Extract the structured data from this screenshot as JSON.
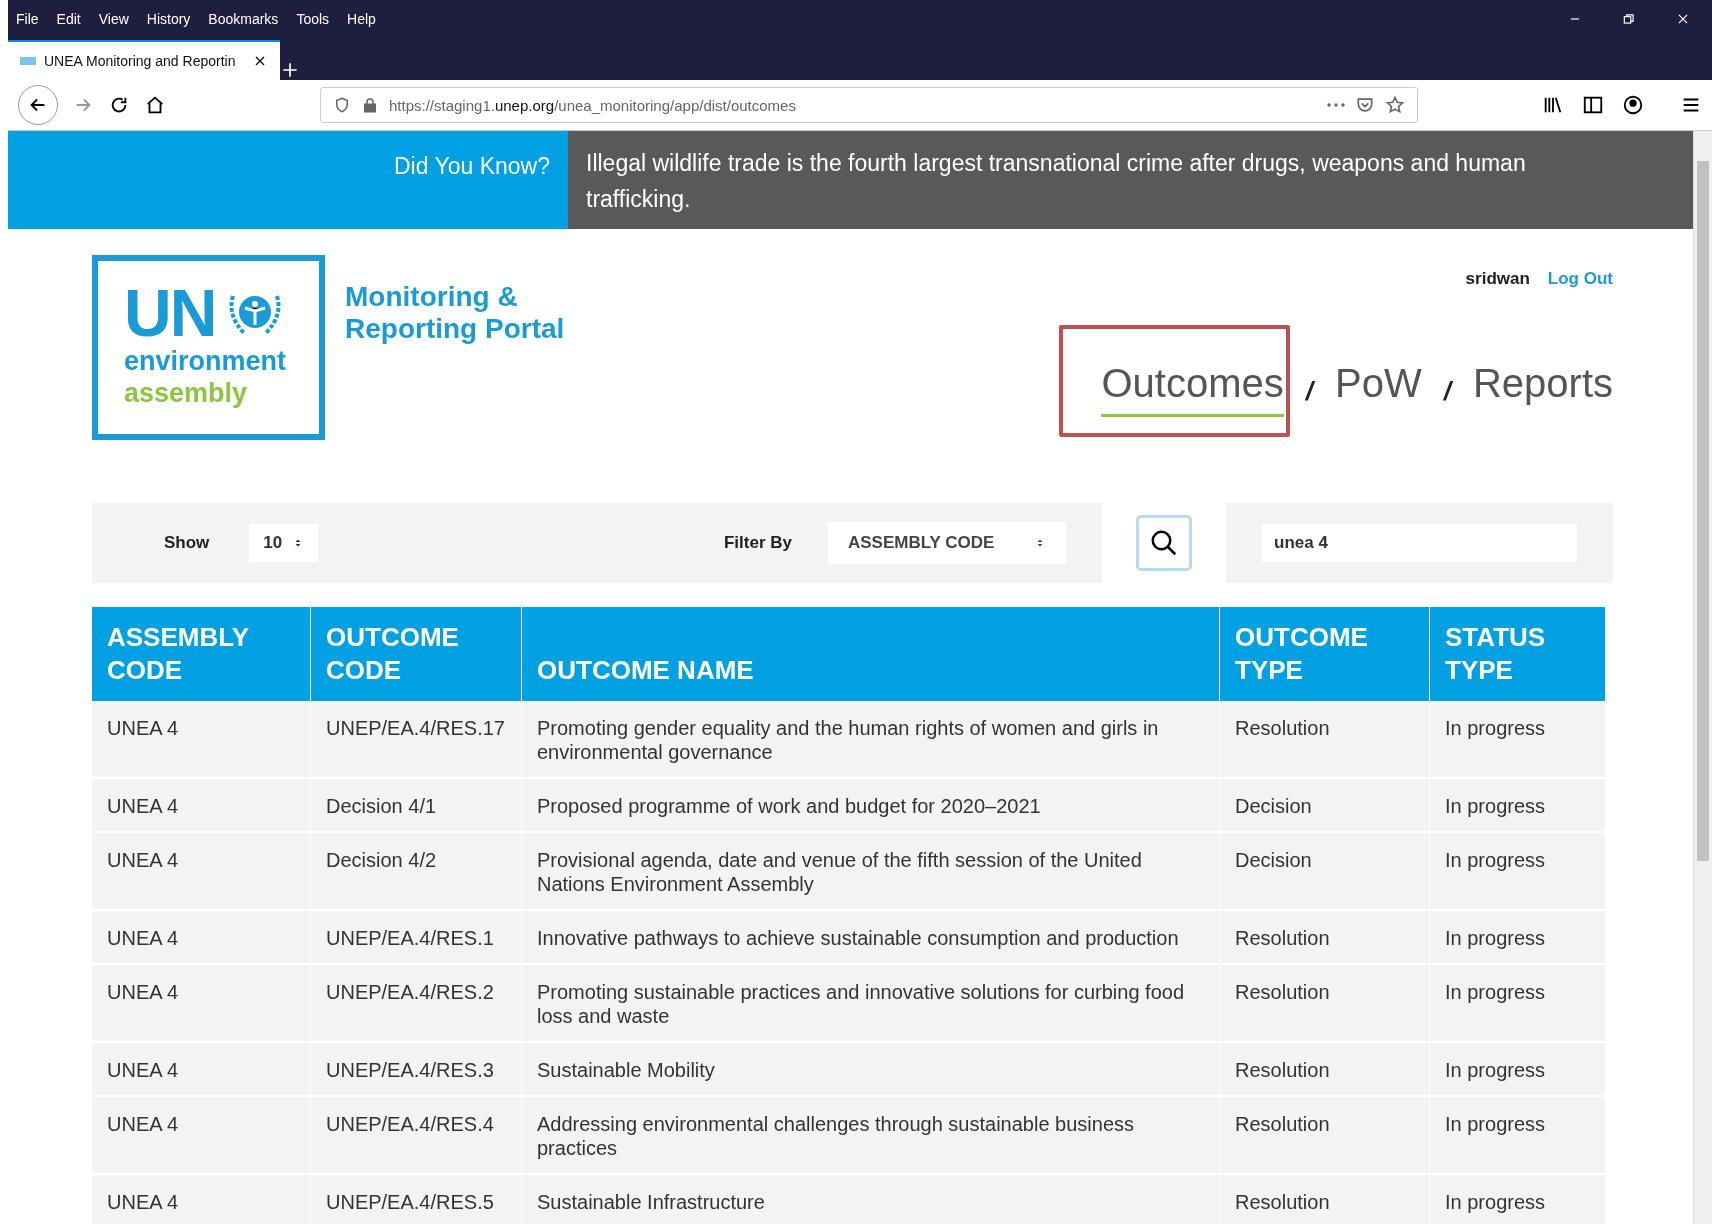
{
  "browser": {
    "menu": [
      "File",
      "Edit",
      "View",
      "History",
      "Bookmarks",
      "Tools",
      "Help"
    ],
    "tab": {
      "title": "UNEA Monitoring and Reportin"
    },
    "url": "https://staging1.**unep.org**/unea_monitoring/app/dist/outcomes"
  },
  "banner": {
    "label": "Did You Know?",
    "text": "Illegal wildlife trade is the fourth largest transnational crime after drugs, weapons and human trafficking."
  },
  "logo": {
    "un": "UN",
    "line1": "environment",
    "line2": "assembly"
  },
  "portal_title": [
    "Monitoring &",
    "Reporting Portal"
  ],
  "user": {
    "name": "sridwan",
    "logout": "Log Out"
  },
  "nav": [
    {
      "label": "Outcomes",
      "selected": true,
      "highlighted": true
    },
    {
      "label": "PoW",
      "selected": false,
      "highlighted": false
    },
    {
      "label": "Reports",
      "selected": false,
      "highlighted": false
    }
  ],
  "nav_separator": "/",
  "filters": {
    "show_label": "Show",
    "show_value": "10",
    "filter_label": "Filter By",
    "filter_value": "ASSEMBLY CODE",
    "search_value": "unea 4"
  },
  "table": {
    "columns": [
      "ASSEMBLY CODE",
      "OUTCOME CODE",
      "OUTCOME NAME",
      "OUTCOME TYPE",
      "STATUS TYPE"
    ],
    "rows": [
      [
        "UNEA 4",
        "UNEP/EA.4/RES.17",
        "Promoting gender equality and the human rights of women and girls in environmental governance",
        "Resolution",
        "In progress"
      ],
      [
        "UNEA 4",
        "Decision 4/1",
        "Proposed programme of work and budget for 2020–2021",
        "Decision",
        "In progress"
      ],
      [
        "UNEA 4",
        "Decision 4/2",
        "Provisional agenda, date and venue of the fifth session of the United Nations Environment Assembly",
        "Decision",
        "In progress"
      ],
      [
        "UNEA 4",
        "UNEP/EA.4/RES.1",
        "Innovative pathways to achieve sustainable consumption and production",
        "Resolution",
        "In progress"
      ],
      [
        "UNEA 4",
        "UNEP/EA.4/RES.2",
        "Promoting sustainable practices and innovative solutions for curbing food loss and waste",
        "Resolution",
        "In progress"
      ],
      [
        "UNEA 4",
        "UNEP/EA.4/RES.3",
        "Sustainable Mobility",
        "Resolution",
        "In progress"
      ],
      [
        "UNEA 4",
        "UNEP/EA.4/RES.4",
        "Addressing environmental challenges through sustainable business practices",
        "Resolution",
        "In progress"
      ],
      [
        "UNEA 4",
        "UNEP/EA.4/RES.5",
        "Sustainable Infrastructure",
        "Resolution",
        "In progress"
      ]
    ]
  }
}
